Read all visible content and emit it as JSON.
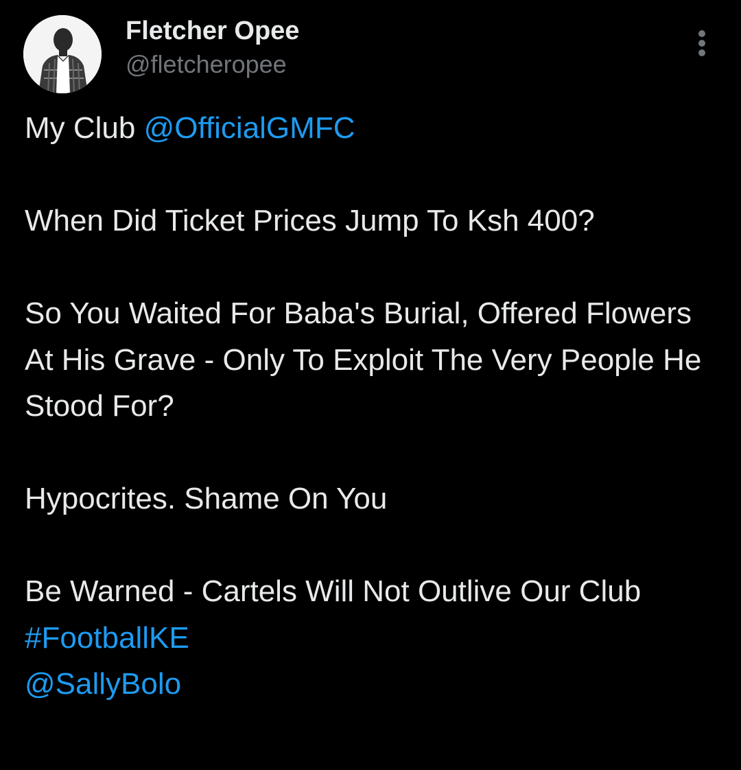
{
  "author": {
    "display_name": "Fletcher Opee",
    "handle": "@fletcheropee",
    "avatar_icon": "profile-photo"
  },
  "more_icon": "more-vertical-icon",
  "colors": {
    "background": "#000000",
    "text": "#e7e9ea",
    "secondary_text": "#71767b",
    "link": "#1d9bf0"
  },
  "tweet": {
    "line1_prefix": "My Club ",
    "mention_club": "@OfficialGMFC",
    "line2": "When Did Ticket Prices Jump To Ksh 400?",
    "line3": "So You Waited For Baba's Burial, Offered Flowers At His Grave - Only To Exploit The Very People He Stood For?",
    "line4": "Hypocrites. Shame On You",
    "line5": "Be Warned - Cartels Will Not Outlive Our Club",
    "hashtag": "#FootballKE",
    "mention_user": "@SallyBolo"
  }
}
